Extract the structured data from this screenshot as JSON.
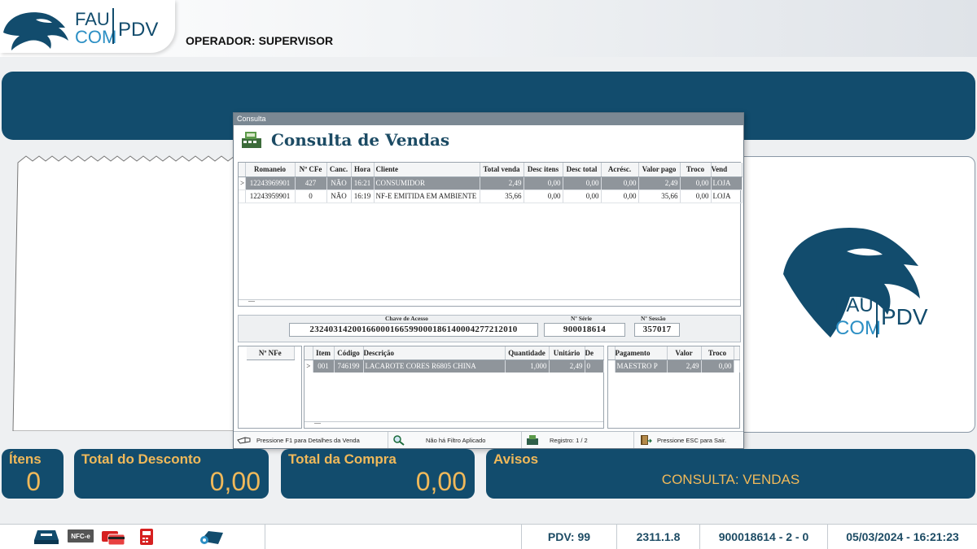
{
  "header": {
    "logo_top": "FAU",
    "logo_bottom": "COM",
    "logo_right": "PDV",
    "operator_label": "OPERADOR:",
    "operator_name": "SUPERVISOR"
  },
  "modal": {
    "window_title": "Consulta",
    "title": "Consulta de Vendas",
    "sales_columns": [
      "Romaneio",
      "Nº CFe",
      "Canc.",
      "Hora",
      "Cliente",
      "Total venda",
      "Desc itens",
      "Desc total",
      "Acrésc.",
      "Valor pago",
      "Troco",
      "Vend"
    ],
    "sales_rows": [
      {
        "indicator": ">",
        "cells": [
          "12243969901",
          "427",
          "NÃO",
          "16:21",
          "CONSUMIDOR",
          "2,49",
          "0,00",
          "0,00",
          "0,00",
          "2,49",
          "0,00",
          "LOJA"
        ]
      },
      {
        "indicator": "",
        "cells": [
          "12243959901",
          "0",
          "NÃO",
          "16:19",
          "NF-E EMITIDA EM AMBIENTE",
          "35,66",
          "0,00",
          "0,00",
          "0,00",
          "35,66",
          "0,00",
          "LOJA"
        ]
      }
    ],
    "grid_footer_marker": "—",
    "chave_label": "Chave de Acesso",
    "chave_value": "23240314200166000166599000186140004277212010",
    "serie_label": "Nº Série",
    "serie_value": "900018614",
    "sessao_label": "Nº Sessão",
    "sessao_value": "357017",
    "nfe_column": "Nº NFe",
    "items_columns": [
      "Item",
      "Código",
      "Descrição",
      "Quantidade",
      "Unitário",
      "De"
    ],
    "items_rows": [
      {
        "indicator": ">",
        "cells": [
          "001",
          "746199",
          "LACAROTE CORES R6805 CHINA",
          "1,000",
          "2,49",
          "0"
        ]
      }
    ],
    "payment_columns": [
      "Pagamento",
      "Valor",
      "Troco"
    ],
    "payment_rows": [
      {
        "cells": [
          "MAESTRO P",
          "2,49",
          "0,00"
        ]
      }
    ],
    "status": {
      "f1": "Pressione F1 para Detalhes da Venda",
      "filter": "Não há Filtro Aplicado",
      "registro": "Registro: 1 / 2",
      "esc": "Pressione ESC para Sair."
    }
  },
  "totals": {
    "itens_label": "Ítens",
    "itens_value": "0",
    "desconto_label": "Total do Desconto",
    "desconto_value": "0,00",
    "compra_label": "Total da Compra",
    "compra_value": "0,00",
    "avisos_label": "Avisos",
    "avisos_message": "CONSULTA: VENDAS"
  },
  "statusbar": {
    "icons": [
      "cash-drawer-icon",
      "nfce-icon",
      "card-payment-icon",
      "printer-icon",
      "paper-roll-icon"
    ],
    "nfce_text": "NFC-e",
    "pdv": "PDV: 99",
    "version": "2311.1.8",
    "serial": "900018614 - 2 - 0",
    "datetime": "05/03/2024 - 16:21:23"
  },
  "colors": {
    "brand_blue": "#124c6d",
    "accent_gold": "#f0b95a",
    "selected_row": "#8f959b"
  }
}
